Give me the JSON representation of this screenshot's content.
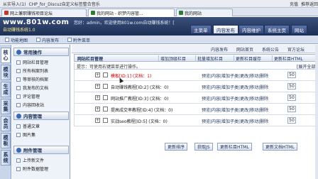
{
  "topbar": {
    "items": [
      "从实导入(1)",
      "CHP_for_Discuz自定义标签整合音乐",
      "充值",
      "推荐返回"
    ]
  },
  "browser_tabs": [
    {
      "label": "网上兼职赚钱项目论坛",
      "color": "#c0392b"
    },
    {
      "label": "我的网站 - 织梦内容管...",
      "color": "#2e7d32",
      "active": true
    },
    {
      "label": "我的网站",
      "color": "#2e7d32"
    }
  ],
  "site": {
    "logo_domain": "www.801w.com",
    "logo_tagline": "自动赚钱系统1.0",
    "welcome": "您好：admin，欢迎使用801w.com自动赚钱系统！[",
    "nav": [
      "主菜单",
      "内容发布",
      "内容维护",
      "系统主页",
      "网站"
    ]
  },
  "subnav": {
    "items": [
      "功能地图",
      "内容发布",
      "附件菜单"
    ]
  },
  "rail": [
    "核心",
    "模块",
    "生成",
    "采集",
    "会员",
    "模板",
    "系统"
  ],
  "sidemenu": {
    "groups": [
      {
        "title": "常用操作",
        "items": [
          "网站栏目管理",
          "所有档案列表",
          "等审核的档案",
          "我发布的文档",
          "评论管理",
          "内容回收站"
        ]
      },
      {
        "title": "内容管理",
        "items": [
          "普通文章",
          "图片集"
        ]
      },
      {
        "title": "附件管理",
        "items": [
          "上传新文件",
          "附件数据管理"
        ]
      }
    ]
  },
  "main": {
    "toplinks": [
      "内容发布",
      "网站首页",
      "系统公告",
      "官方论坛"
    ],
    "panel_title": "网站栏目管理",
    "panel_tabs": [
      "增加顶级栏目",
      "批量增加栏目",
      "更新栏目缓存",
      "更新栏目HTML"
    ],
    "hint": "提示：可使用右键菜单进行操作。",
    "expand_all": "[展开全部]",
    "rows": [
      {
        "name": "模板[ID:1] (文档：1)",
        "actions": "预览|内容|增加子类|更改|移动|删除",
        "order": "50",
        "highlight": true
      },
      {
        "name": "自动赚钱教程[ID:2] (文档：0)",
        "actions": "预览|内容|增加子类|更改|移动|删除",
        "order": "50"
      },
      {
        "name": "网站推广教程[ID:3] (文档：0)",
        "actions": "预览|内容|增加子类|更改|移动|删除",
        "order": "50"
      },
      {
        "name": "提高成交率教程[ID:4] (文档：0)",
        "actions": "预览|内容|增加子类|更改|移动|删除",
        "order": "50"
      },
      {
        "name": "实战seo教程[ID:5] (文档：0)",
        "actions": "预览|内容|增加子类|更改|移动|删除",
        "order": "50"
      }
    ],
    "buttons": [
      "更新排序",
      "获取JS",
      "更新栏目HTML",
      "更新文档HTML"
    ]
  }
}
